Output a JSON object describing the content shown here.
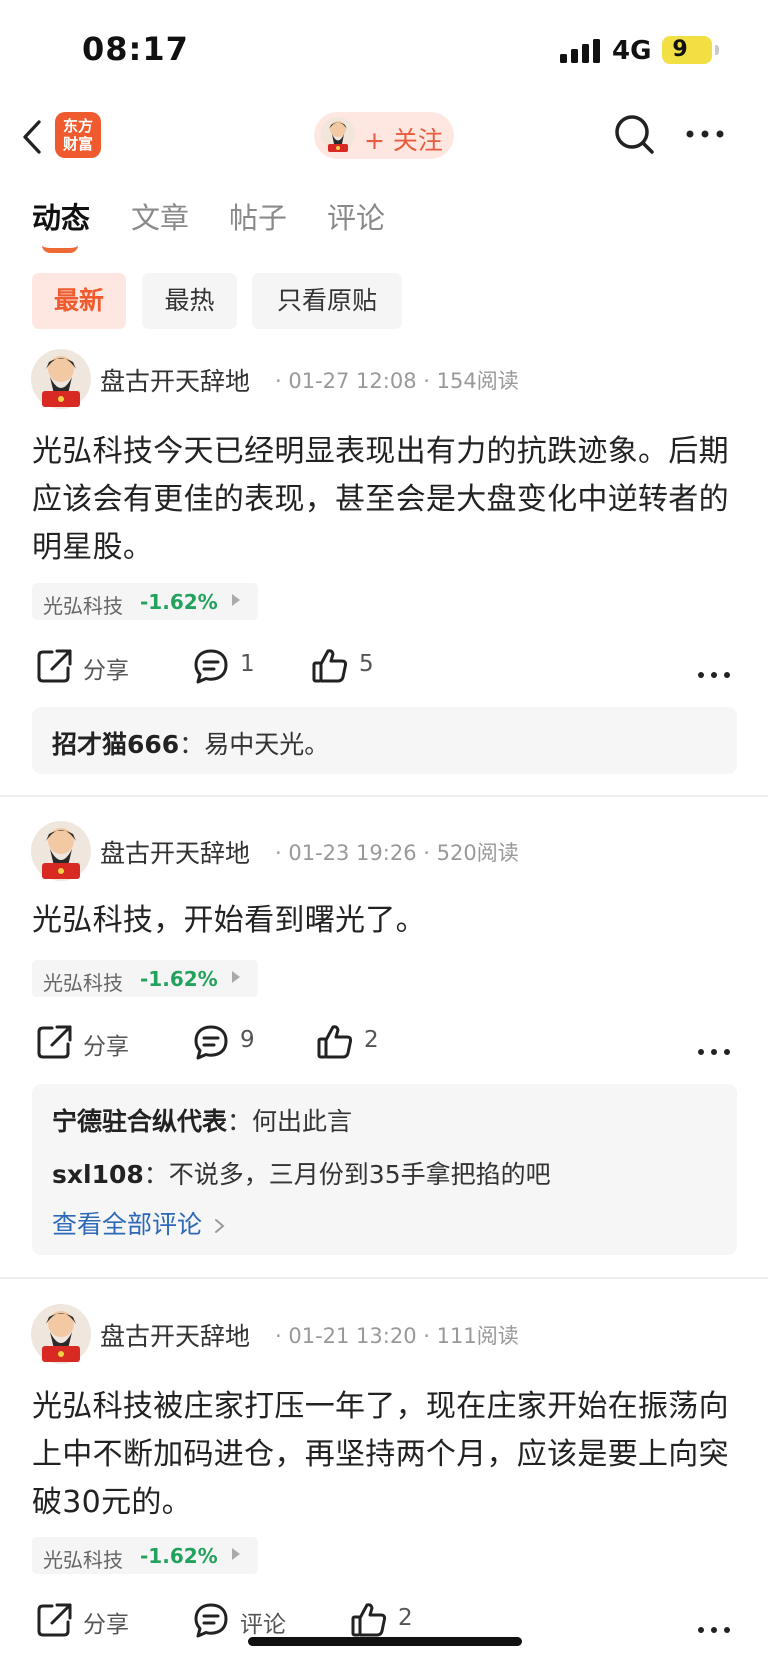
{
  "status_bar": {
    "time": "08:17",
    "network": "4G",
    "battery": "9",
    "battery_color": "#f1df43"
  },
  "nav": {
    "logo_line1": "东方",
    "logo_line2": "财富",
    "follow_label": "+ 关注",
    "icons": [
      "back-icon",
      "search-icon",
      "more-icon"
    ]
  },
  "tabs": [
    {
      "label": "动态",
      "active": true
    },
    {
      "label": "文章",
      "active": false
    },
    {
      "label": "帖子",
      "active": false
    },
    {
      "label": "评论",
      "active": false
    }
  ],
  "filters": [
    {
      "label": "最新",
      "active": true
    },
    {
      "label": "最热",
      "active": false
    },
    {
      "label": "只看原贴",
      "active": false
    }
  ],
  "accent_color": "#ef5a2e",
  "stock_down_color": "#22a25d",
  "posts": [
    {
      "author": "盘古开天辞地",
      "time": "01-27 12:08",
      "reads": "154阅读",
      "content": "光弘科技今天已经明显表现出有力的抗跌迹象。后期应该会有更佳的表现，甚至会是大盘变化中逆转者的明星股。",
      "stock_name": "光弘科技",
      "stock_change": "-1.62%",
      "share_label": "分享",
      "comments": "1",
      "likes": "5",
      "replies": [
        {
          "user": "招才猫666",
          "text": "易中天光。"
        }
      ]
    },
    {
      "author": "盘古开天辞地",
      "time": "01-23 19:26",
      "reads": "520阅读",
      "content": "光弘科技，开始看到曙光了。",
      "stock_name": "光弘科技",
      "stock_change": "-1.62%",
      "share_label": "分享",
      "comments": "9",
      "likes": "2",
      "replies": [
        {
          "user": "宁德驻合纵代表",
          "text": "何出此言"
        },
        {
          "user": "sxl108",
          "text": "不说多，三月份到35手拿把掐的吧"
        }
      ],
      "view_all": "查看全部评论"
    },
    {
      "author": "盘古开天辞地",
      "time": "01-21 13:20",
      "reads": "111阅读",
      "content": "光弘科技被庄家打压一年了，现在庄家开始在振荡向上中不断加码进仓，再坚持两个月，应该是要上向突破30元的。",
      "stock_name": "光弘科技",
      "stock_change": "-1.62%",
      "share_label": "分享",
      "comment_label": "评论",
      "likes": "2"
    }
  ]
}
